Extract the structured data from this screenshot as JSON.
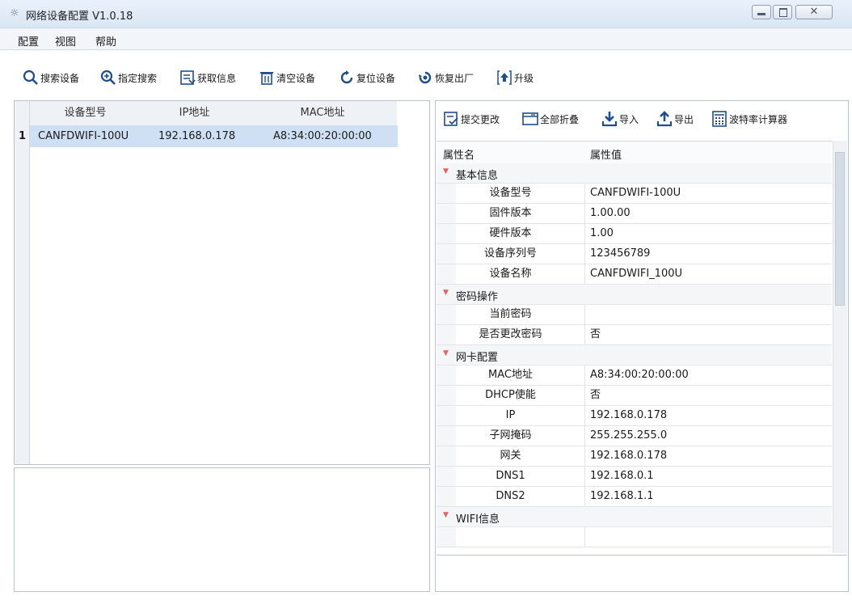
{
  "window": {
    "title": "网络设备配置 V1.0.18"
  },
  "menu": [
    "配置",
    "视图",
    "帮助"
  ],
  "toolbar": {
    "search": "搜索设备",
    "specified_search": "指定搜索",
    "get_info": "获取信息",
    "clear": "清空设备",
    "reset": "复位设备",
    "factory": "恢复出厂",
    "upgrade": "升级"
  },
  "device_table": {
    "headers": [
      "设备型号",
      "IP地址",
      "MAC地址"
    ],
    "rows": [
      {
        "index": "1",
        "model": "CANFDWIFI-100U",
        "ip": "192.168.0.178",
        "mac": "A8:34:00:20:00:00"
      }
    ]
  },
  "props_toolbar": {
    "submit": "提交更改",
    "collapse": "全部折叠",
    "import": "导入",
    "export": "导出",
    "baud": "波特率计算器"
  },
  "props": {
    "header_name": "属性名",
    "header_value": "属性值",
    "cat_basic": "基本信息",
    "model_k": "设备型号",
    "model_v": "CANFDWIFI-100U",
    "fw_k": "固件版本",
    "fw_v": "1.00.00",
    "hw_k": "硬件版本",
    "hw_v": "1.00",
    "sn_k": "设备序列号",
    "sn_v": "123456789",
    "name_k": "设备名称",
    "name_v": "CANFDWIFI_100U",
    "cat_pwd": "密码操作",
    "curpwd_k": "当前密码",
    "curpwd_v": "",
    "chgpwd_k": "是否更改密码",
    "chgpwd_v": "否",
    "cat_nic": "网卡配置",
    "mac_k": "MAC地址",
    "mac_v": "A8:34:00:20:00:00",
    "dhcp_k": "DHCP使能",
    "dhcp_v": "否",
    "ip_k": "IP",
    "ip_v": "192.168.0.178",
    "mask_k": "子网掩码",
    "mask_v": "255.255.255.0",
    "gw_k": "网关",
    "gw_v": "192.168.0.178",
    "dns1_k": "DNS1",
    "dns1_v": "192.168.0.1",
    "dns2_k": "DNS2",
    "dns2_v": "192.168.1.1",
    "cat_wifi": "WIFI信息"
  }
}
